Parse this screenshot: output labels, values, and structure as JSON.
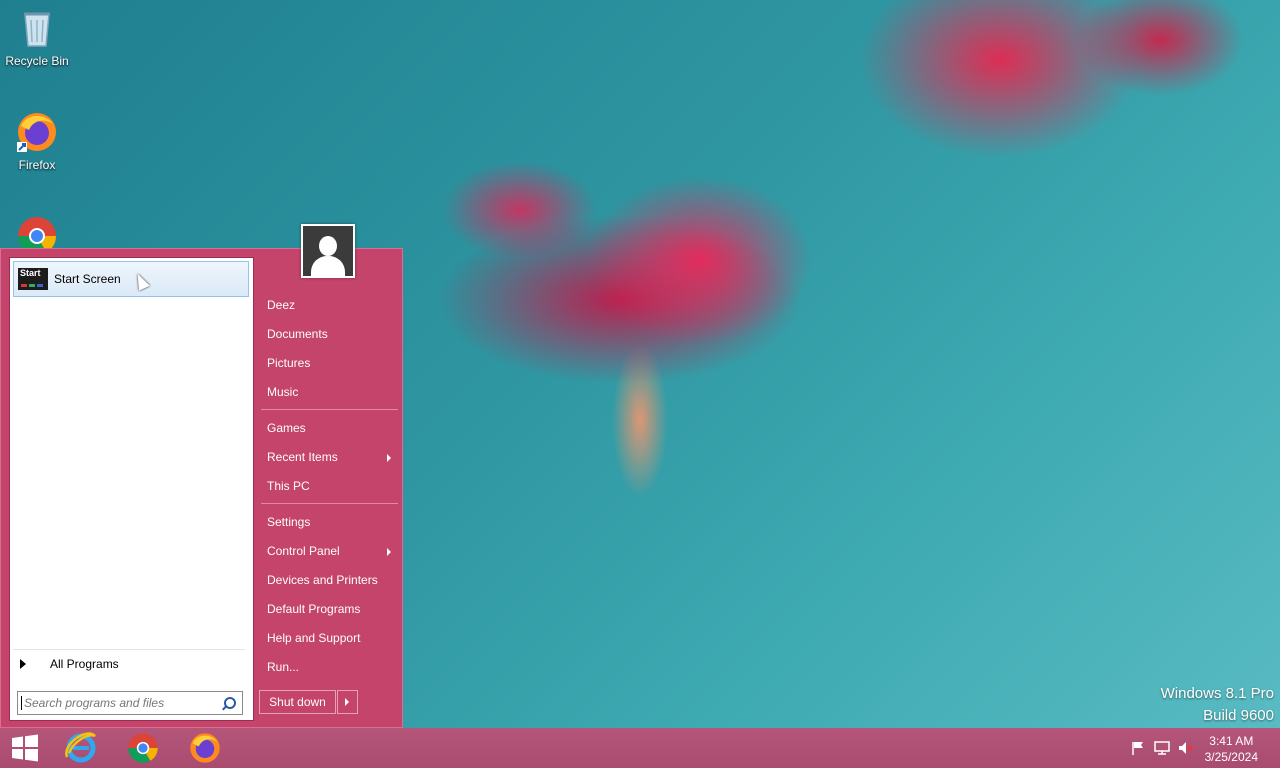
{
  "desktop": {
    "icons": [
      {
        "label": "Recycle Bin",
        "icon": "recycle-bin-icon"
      },
      {
        "label": "Firefox",
        "icon": "firefox-icon"
      },
      {
        "label": "",
        "icon": "chrome-icon"
      }
    ],
    "watermark": {
      "line1": "Windows 8.1 Pro",
      "line2": "Build 9600"
    }
  },
  "start_menu": {
    "pinned": {
      "tile_text": "Start",
      "label": "Start Screen"
    },
    "all_programs": "All Programs",
    "search_placeholder": "Search programs and files",
    "right_items": [
      {
        "label": "Deez"
      },
      {
        "label": "Documents"
      },
      {
        "label": "Pictures"
      },
      {
        "label": "Music"
      },
      {
        "label": "Games"
      },
      {
        "label": "Recent Items",
        "submenu": true
      },
      {
        "label": "This PC"
      },
      {
        "label": "Settings"
      },
      {
        "label": "Control Panel",
        "submenu": true
      },
      {
        "label": "Devices and Printers"
      },
      {
        "label": "Default Programs"
      },
      {
        "label": "Help and Support"
      },
      {
        "label": "Run..."
      }
    ],
    "shutdown_label": "Shut down",
    "accent": "#c4446c"
  },
  "taskbar": {
    "apps": [
      "start-button",
      "internet-explorer-icon",
      "chrome-icon",
      "firefox-icon"
    ],
    "clock": {
      "time": "3:41 AM",
      "date": "3/25/2024"
    },
    "color": "#b5557a"
  }
}
